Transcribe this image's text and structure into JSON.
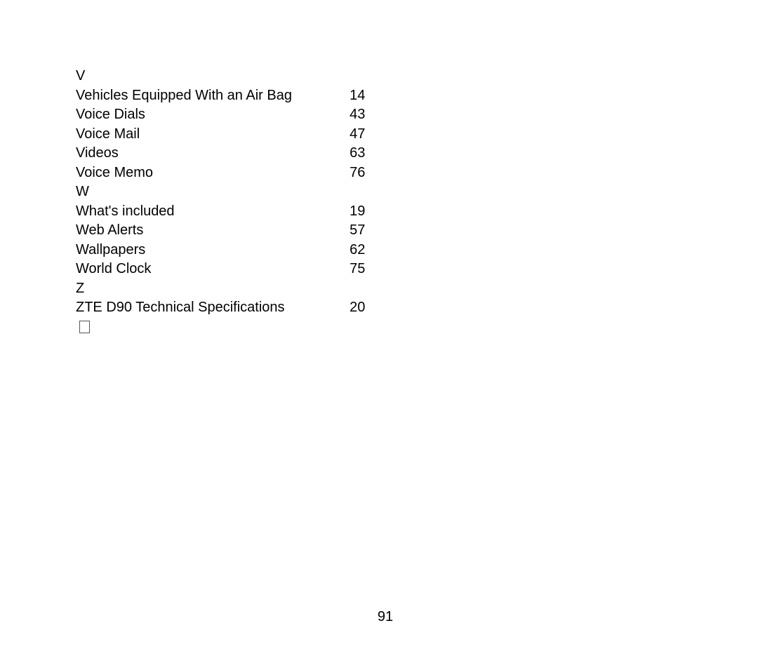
{
  "index": {
    "sections": [
      {
        "letter": "V",
        "entries": [
          {
            "term": "Vehicles Equipped With an Air Bag",
            "page": "14"
          },
          {
            "term": "Voice Dials",
            "page": "43"
          },
          {
            "term": "Voice Mail",
            "page": "47"
          },
          {
            "term": "Videos",
            "page": "63"
          },
          {
            "term": "Voice Memo",
            "page": "76"
          }
        ]
      },
      {
        "letter": "W",
        "entries": [
          {
            "term": "What's included",
            "page": "19"
          },
          {
            "term": "Web Alerts",
            "page": "57"
          },
          {
            "term": "Wallpapers",
            "page": "62"
          },
          {
            "term": "World Clock",
            "page": "75"
          }
        ]
      },
      {
        "letter": "Z",
        "entries": [
          {
            "term": "ZTE D90 Technical Specifications",
            "page": "20"
          }
        ]
      }
    ]
  },
  "footer": {
    "page_number": "91"
  }
}
